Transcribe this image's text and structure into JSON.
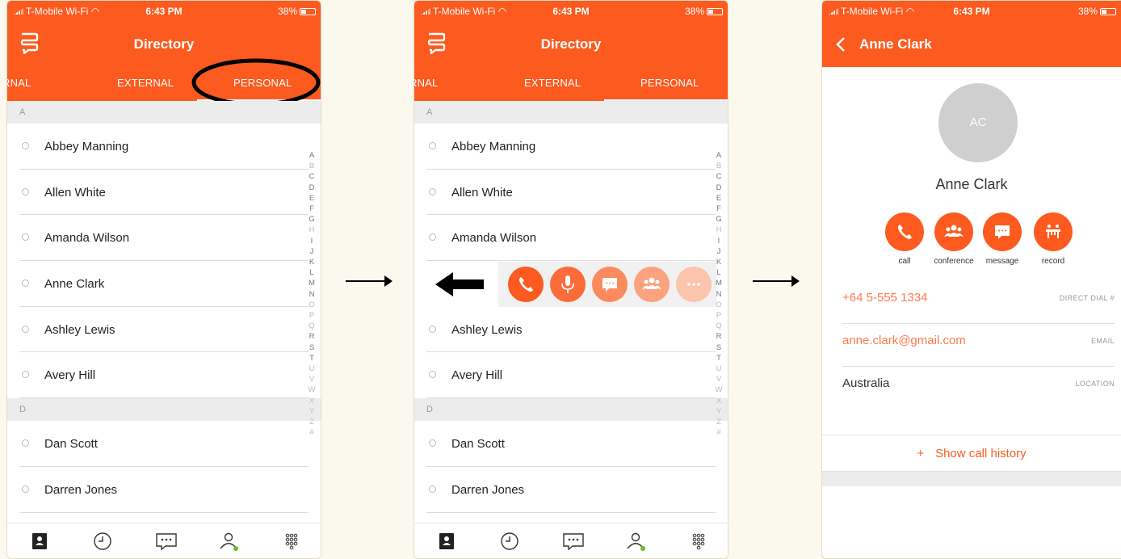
{
  "status": {
    "carrier": "T-Mobile Wi-Fi",
    "time": "6:43 PM",
    "battery": "38%"
  },
  "brand_color": "#fc5a1f",
  "directory": {
    "title": "Directory",
    "tabs": [
      "RNAL",
      "EXTERNAL",
      "PERSONAL"
    ],
    "active_tab": "PERSONAL",
    "sections": [
      {
        "letter": "A",
        "contacts": [
          "Abbey Manning",
          "Allen White",
          "Amanda Wilson",
          "Anne Clark",
          "Ashley Lewis",
          "Avery Hill"
        ]
      },
      {
        "letter": "D",
        "contacts": [
          "Dan Scott",
          "Darren Jones"
        ]
      }
    ],
    "alphabet": [
      "A",
      "B",
      "C",
      "D",
      "E",
      "F",
      "G",
      "H",
      "I",
      "J",
      "K",
      "L",
      "M",
      "N",
      "O",
      "P",
      "Q",
      "R",
      "S",
      "T",
      "U",
      "V",
      "W",
      "X",
      "Y",
      "Z",
      "#"
    ],
    "nav_icons": [
      "directory-icon",
      "history-icon",
      "messages-icon",
      "contacts-icon",
      "dialpad-icon"
    ]
  },
  "swipe_actions": [
    "call-icon",
    "mic-icon",
    "message-icon",
    "conference-icon",
    "more-icon"
  ],
  "contact": {
    "name": "Anne Clark",
    "initials": "AC",
    "actions": [
      "call",
      "conference",
      "message",
      "record"
    ],
    "phone": "+64 5-555 1334",
    "phone_label": "DIRECT DIAL #",
    "email": "anne.clark@gmail.com",
    "email_label": "EMAIL",
    "location": "Australia",
    "location_label": "LOCATION",
    "history_plus": "+",
    "history": "Show call history"
  }
}
